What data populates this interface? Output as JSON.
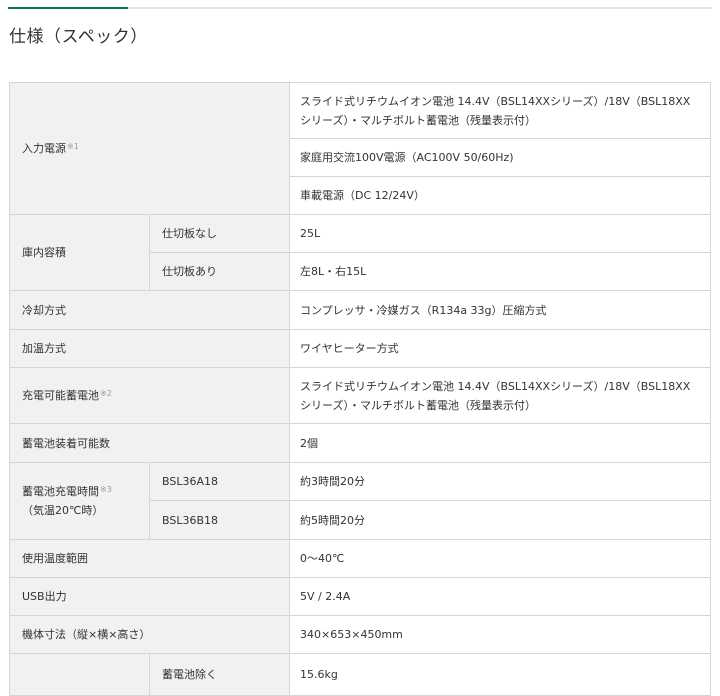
{
  "heading": "仕様（スペック）",
  "rows": {
    "power": {
      "label": "入力電源",
      "note": "※1",
      "values": [
        "スライド式リチウムイオン電池 14.4V（BSL14XXシリーズ）/18V（BSL18XXシリーズ）・マルチボルト蓄電池（残量表示付）",
        "家庭用交流100V電源（AC100V 50/60Hz)",
        "車載電源（DC 12/24V）"
      ]
    },
    "capacity": {
      "label": "庫内容積",
      "sub": [
        {
          "label": "仕切板なし",
          "value": "25L"
        },
        {
          "label": "仕切板あり",
          "value": "左8L・右15L"
        }
      ]
    },
    "cooling": {
      "label": "冷却方式",
      "value": "コンプレッサ・冷媒ガス（R134a 33g）圧縮方式"
    },
    "heating": {
      "label": "加温方式",
      "value": "ワイヤヒーター方式"
    },
    "battery": {
      "label": "充電可能蓄電池",
      "note": "※2",
      "value": "スライド式リチウムイオン電池 14.4V（BSL14XXシリーズ）/18V（BSL18XXシリーズ）・マルチボルト蓄電池（残量表示付）"
    },
    "battery_count": {
      "label": "蓄電池装着可能数",
      "value": "2個"
    },
    "charge_time": {
      "label": "蓄電池充電時間",
      "note": "※3",
      "label2": "（気温20℃時）",
      "sub": [
        {
          "label": "BSL36A18",
          "value": "約3時間20分"
        },
        {
          "label": "BSL36B18",
          "value": "約5時間20分"
        }
      ]
    },
    "temp_range": {
      "label": "使用温度範囲",
      "value": "0～40℃"
    },
    "usb": {
      "label": "USB出力",
      "value": "5V / 2.4A"
    },
    "dimensions": {
      "label": "機体寸法（縦×横×高さ）",
      "value": "340×653×450mm"
    },
    "weight": {
      "label": "",
      "sub_label": "蓄電池除く",
      "value": "15.6kg"
    }
  }
}
